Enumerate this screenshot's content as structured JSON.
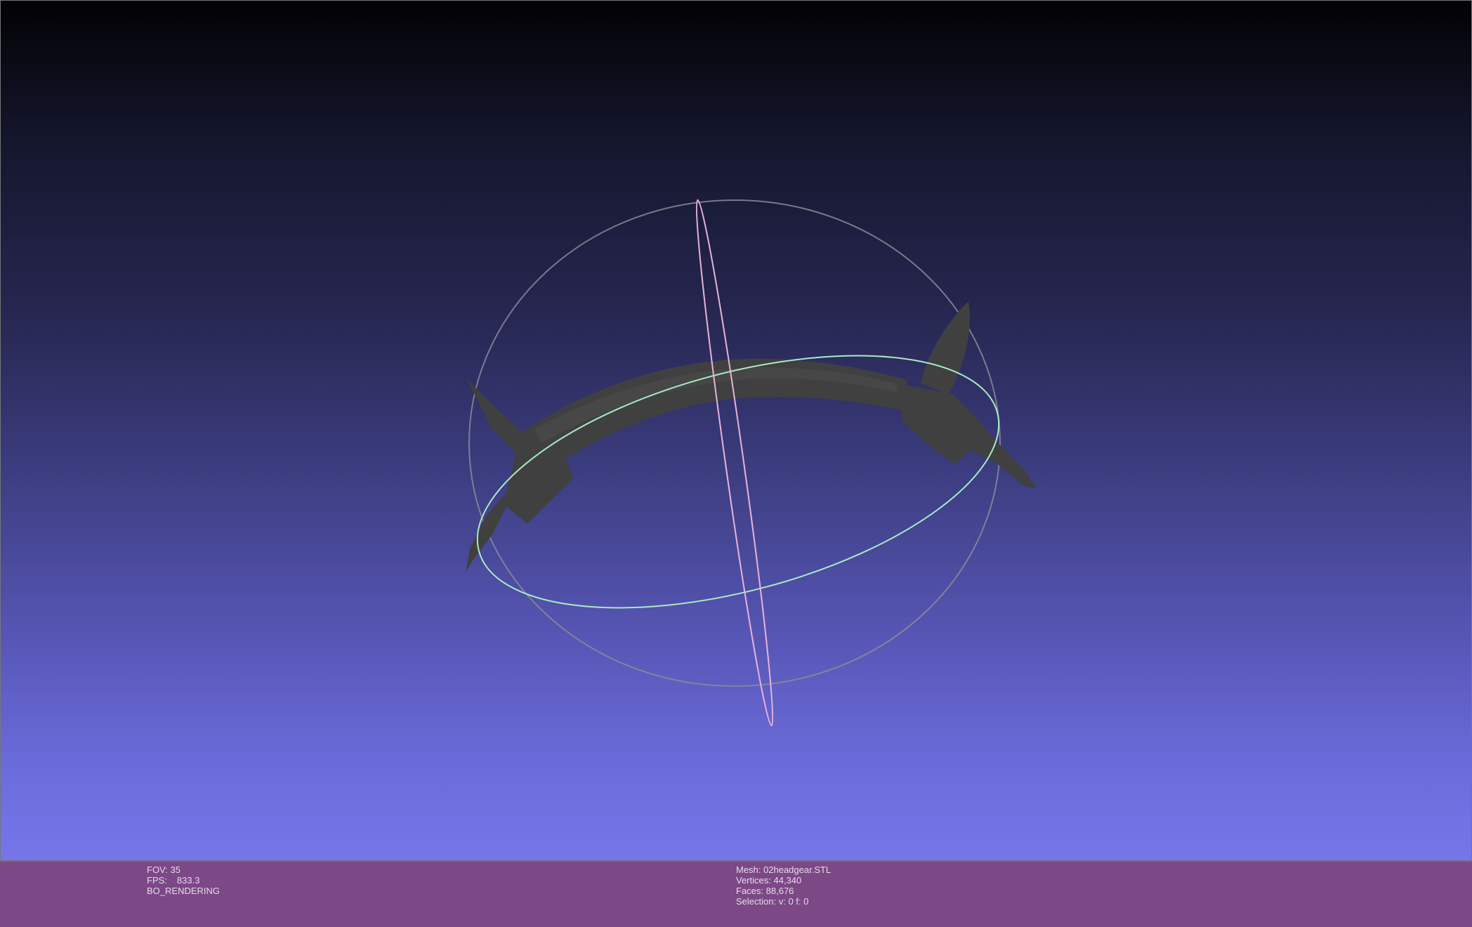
{
  "viewer": {
    "background_top": "#020204",
    "background_bottom": "#7676ea",
    "info_bar_color": "#7c4886",
    "mesh_color": "#404040",
    "trackball_colors": {
      "horizontal": "#a8ebc4",
      "vertical": "#e8b4d8",
      "outer": "#8a8a9a"
    }
  },
  "info_left": {
    "fov_label": "FOV:",
    "fov_value": "35",
    "fps_label": "FPS:",
    "fps_value": "833.3",
    "render_mode": "BO_RENDERING"
  },
  "info_right": {
    "mesh_label": "Mesh:",
    "mesh_value": "02headgear.STL",
    "vertices_label": "Vertices:",
    "vertices_value": "44,340",
    "faces_label": "Faces:",
    "faces_value": "88,676",
    "selection_label": "Selection:",
    "selection_value": "v: 0 f: 0"
  }
}
